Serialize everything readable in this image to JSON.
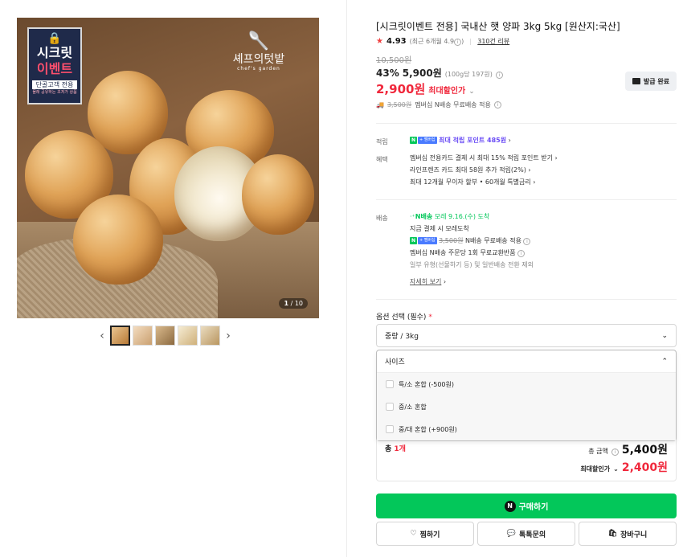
{
  "gallery": {
    "secret_badge": {
      "line1": "시크릿",
      "line2": "이벤트",
      "line3": "단골고객 전용",
      "line4": "몰래 공유하는 초저가 상품"
    },
    "brand_logo": {
      "title": "셰프의텃밭",
      "subtitle": "chef's garden"
    },
    "counter_current": "1",
    "counter_total": "10"
  },
  "product": {
    "title": "[시크릿이벤트 전용] 국내산 햇 양파 3kg 5kg [원산지:국산]",
    "rating": "4.93",
    "rating_note": "(최근 6개월 4.9",
    "rating_note_end": ")",
    "reviews": "310건 리뷰",
    "original_price": "10,500원",
    "discount": "43%",
    "sale_price": "5,900원",
    "unit_price": "(100g당 197원)",
    "max_price": "2,900원",
    "max_label": "최대할인가",
    "coupon_label": "발급 완료",
    "shipping_strike": "3,500원",
    "shipping_text": "멤버십 N배송 무료배송 적용"
  },
  "benefits": {
    "points_label": "적립",
    "points_text": "최대 적립 포인트 485원",
    "benefit_label": "혜택",
    "benefit_lines": [
      "멤버십 전용카드 결제 시 최대 15% 적립 포인트 받기",
      "라인프렌즈 카드 최대 58원 추가 적립(2%)",
      "최대 12개월 무이자 할부 • 60개월 특별금리"
    ]
  },
  "delivery": {
    "label": "배송",
    "badge": "N배송",
    "arrival": "모레 9.16.(수) 도착",
    "line1": "지금 결제 시 모레도착",
    "strike": "3,500원",
    "line2": "N배송 무료배송 적용",
    "line3": "멤버십 N배송 주문당 1회 무료교환반품",
    "line4": "일부 유형(선물하기 등) 및 일반배송 전환 제외",
    "more": "자세히 보기"
  },
  "options": {
    "title": "옵션 선택 (필수)",
    "required_mark": "*",
    "select1_value": "중량 / 3kg",
    "select2_header": "사이즈",
    "items": [
      "특/소 혼합 (-500원)",
      "중/소 혼합",
      "중/대 혼합 (+900원)"
    ]
  },
  "summary": {
    "qty_label": "총 ",
    "qty_value": "1개",
    "total_label": "총 금액",
    "total_value": "5,400원",
    "max_label": "최대할인가",
    "max_value": "2,400원"
  },
  "actions": {
    "buy": "구매하기",
    "wish": "찜하기",
    "talk": "톡톡문의",
    "cart": "장바구니"
  }
}
